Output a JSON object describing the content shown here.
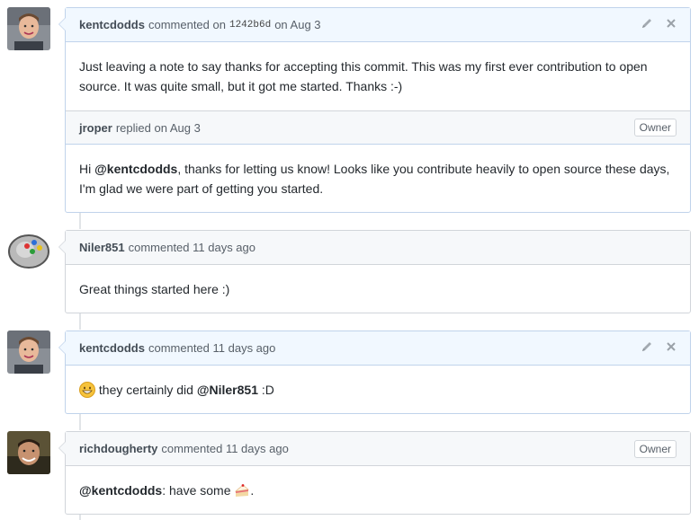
{
  "comments": [
    {
      "author": "kentcdodds",
      "action_pre": "commented on",
      "sha": "1242b6d",
      "action_post": "on Aug 3",
      "body": "Just leaving a note to say thanks for accepting this commit. This was my first ever contribution to open source. It was quite small, but it got me started. Thanks :-)",
      "reply": {
        "author": "jroper",
        "action": "replied on Aug 3",
        "badge": "Owner",
        "greeting": "Hi",
        "mention": "@kentcdodds",
        "body_rest": ", thanks for letting us know! Looks like you contribute heavily to open source these days, I'm glad we were part of getting you started."
      }
    },
    {
      "author": "Niler851",
      "action": "commented 11 days ago",
      "body": "Great things started here :)"
    },
    {
      "author": "kentcdodds",
      "action": "commented 11 days ago",
      "body_pre": "they certainly did",
      "mention": "@Niler851",
      "body_post": ":D"
    },
    {
      "author": "richdougherty",
      "action": "commented 11 days ago",
      "badge": "Owner",
      "mention": "@kentcdodds",
      "body_post": ": have some",
      "body_end": "."
    }
  ],
  "icons": {
    "edit": "pencil-icon",
    "delete": "close-icon"
  },
  "colors": {
    "header_bg": "#f6f8fa",
    "own_header_bg": "#f1f8ff",
    "border": "#d1d5da"
  }
}
